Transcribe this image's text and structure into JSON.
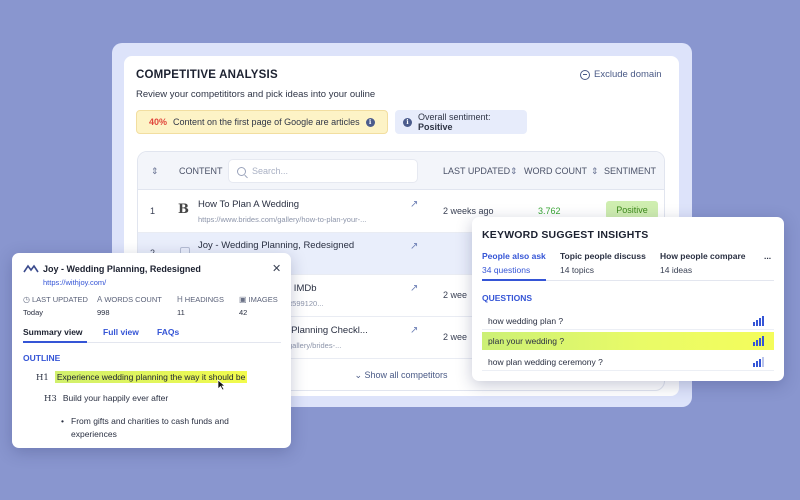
{
  "competitive": {
    "title": "COMPETITIVE ANALYSIS",
    "exclude_label": "Exclude domain",
    "subtitle": "Review your competititors and pick ideas into your ouline",
    "google_pct": "40%",
    "google_text": "Content on the first page of Google are articles",
    "sentiment_label": "Overall sentiment:",
    "sentiment_value": "Positive",
    "table": {
      "col_content": "CONTENT",
      "search_placeholder": "Search...",
      "col_updated": "LAST UPDATED",
      "col_wordcount": "WORD COUNT",
      "col_sentiment": "SENTIMENT",
      "rows": [
        {
          "num": "1",
          "title": "How To Plan A Wedding",
          "url": "https://www.brides.com/gallery/how-to-plan-your-...",
          "updated": "2 weeks ago",
          "wordcount": "3.762",
          "sentiment": "Positive"
        },
        {
          "num": "2",
          "title": "Joy - Wedding Planning, Redesigned",
          "url": "",
          "updated": "",
          "wordcount": "",
          "sentiment": ""
        },
        {
          "num": "",
          "title": "- IMDb",
          "url": "tt599120...",
          "updated": "2 wee",
          "wordcount": "",
          "sentiment": ""
        },
        {
          "num": "",
          "title": "-Planning Checkl...",
          "url": "gallery/brides-...",
          "updated": "2 wee",
          "wordcount": "",
          "sentiment": ""
        }
      ],
      "show_all": "Show all competitors"
    }
  },
  "keyword": {
    "title": "KEYWORD SUGGEST INSIGHTS",
    "tabs": [
      {
        "label": "People also ask",
        "count": "34 questions"
      },
      {
        "label": "Topic people discuss",
        "count": "14 topics"
      },
      {
        "label": "How people compare",
        "count": "14 ideas"
      },
      {
        "label": "...",
        "count": ""
      }
    ],
    "section": "QUESTIONS",
    "questions": [
      {
        "text": "how wedding plan ?",
        "strength": 4
      },
      {
        "text": "plan your wedding ?",
        "strength": 4
      },
      {
        "text": "how plan wedding ceremony ?",
        "strength": 3
      }
    ]
  },
  "joy": {
    "title": "Joy - Wedding Planning, Redesigned",
    "url": "https://withjoy.com/",
    "stats": [
      {
        "icon": "clock-icon",
        "label": "LAST UPDATED",
        "value": "Today"
      },
      {
        "icon": "font-icon",
        "label": "WORDS COUNT",
        "value": "998"
      },
      {
        "icon": "heading-icon",
        "label": "HEADINGS",
        "value": "11"
      },
      {
        "icon": "image-icon",
        "label": "IMAGES",
        "value": "42"
      }
    ],
    "tabs": [
      "Summary view",
      "Full view",
      "FAQs"
    ],
    "outline_label": "OUTLINE",
    "h1_tag": "H1",
    "h1_text": "Experience wedding planning the way it should be",
    "h3_tag": "H3",
    "h3_text": "Build your happily ever after",
    "bullet": "From gifts and charities to cash funds and experiences"
  },
  "colors": {
    "background": "#8996cf",
    "accent": "#3555d6",
    "positive": "#3aa835",
    "highlight": "#e9fb67"
  }
}
